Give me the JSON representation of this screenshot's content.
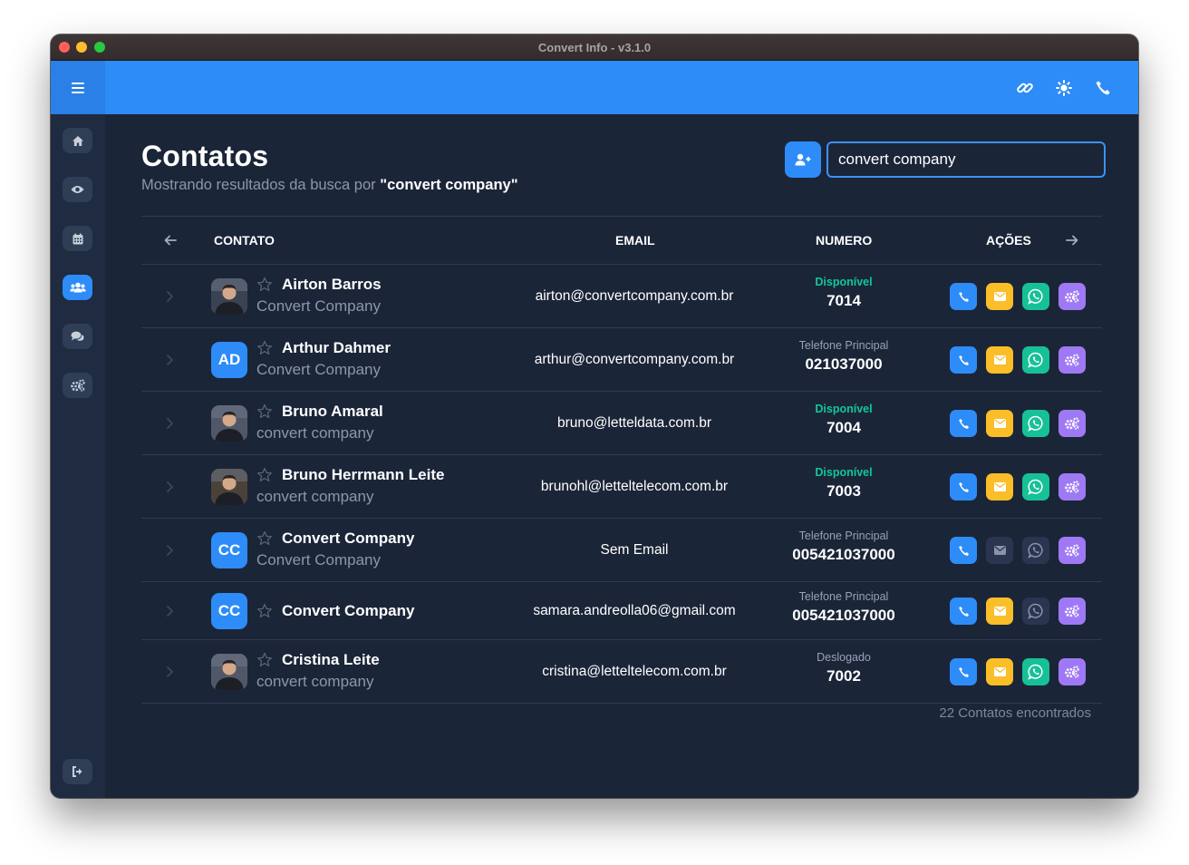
{
  "window": {
    "title": "Convert Info - v3.1.0"
  },
  "header": {
    "menu_icon": "hamburger-icon",
    "actions": [
      {
        "name": "link",
        "icon": "link-icon"
      },
      {
        "name": "theme",
        "icon": "sun-icon"
      },
      {
        "name": "phone",
        "icon": "phone-icon"
      }
    ]
  },
  "sidebar": {
    "items": [
      {
        "name": "home",
        "icon": "home-icon",
        "active": false
      },
      {
        "name": "monitor",
        "icon": "eye-icon",
        "active": false
      },
      {
        "name": "calendar",
        "icon": "calendar-icon",
        "active": false
      },
      {
        "name": "contacts",
        "icon": "users-icon",
        "active": true
      },
      {
        "name": "chat",
        "icon": "comments-icon",
        "active": false
      },
      {
        "name": "settings",
        "icon": "gears-icon",
        "active": false
      }
    ],
    "logout_icon": "sign-out-icon"
  },
  "page": {
    "title": "Contatos",
    "subtitle_prefix": "Mostrando resultados da busca por",
    "subtitle_query": "\"convert company\"",
    "search_value": "convert company",
    "add_contact_icon": "user-plus-icon"
  },
  "table": {
    "headers": {
      "contact": "CONTATO",
      "email": "EMAIL",
      "number": "NUMERO",
      "actions": "AÇÕES"
    },
    "rows": [
      {
        "name": "Airton Barros",
        "company": "Convert Company",
        "avatar_type": "photo",
        "initials": "",
        "email": "airton@convertcompany.com.br",
        "status": "Disponível",
        "status_type": "available",
        "number": "7014",
        "email_enabled": true,
        "whatsapp_enabled": true
      },
      {
        "name": "Arthur Dahmer",
        "company": "Convert Company",
        "avatar_type": "initials",
        "initials": "AD",
        "email": "arthur@convertcompany.com.br",
        "status": "Telefone Principal",
        "status_type": "neutral",
        "number": "021037000",
        "email_enabled": true,
        "whatsapp_enabled": true
      },
      {
        "name": "Bruno Amaral",
        "company": "convert company",
        "avatar_type": "photo",
        "initials": "",
        "email": "bruno@letteldata.com.br",
        "status": "Disponível",
        "status_type": "available",
        "number": "7004",
        "email_enabled": true,
        "whatsapp_enabled": true
      },
      {
        "name": "Bruno Herrmann Leite",
        "company": "convert company",
        "avatar_type": "photo",
        "initials": "",
        "email": "brunohl@letteltelecom.com.br",
        "status": "Disponível",
        "status_type": "available",
        "number": "7003",
        "email_enabled": true,
        "whatsapp_enabled": true
      },
      {
        "name": "Convert Company",
        "company": "Convert Company",
        "avatar_type": "initials",
        "initials": "CC",
        "email": "Sem Email",
        "status": "Telefone Principal",
        "status_type": "neutral",
        "number": "005421037000",
        "email_enabled": false,
        "whatsapp_enabled": false
      },
      {
        "name": "Convert Company",
        "company": "",
        "avatar_type": "initials",
        "initials": "CC",
        "email": "samara.andreolla06@gmail.com",
        "status": "Telefone Principal",
        "status_type": "neutral",
        "number": "005421037000",
        "email_enabled": true,
        "whatsapp_enabled": false
      },
      {
        "name": "Cristina Leite",
        "company": "convert company",
        "avatar_type": "photo",
        "initials": "",
        "email": "cristina@letteltelecom.com.br",
        "status": "Deslogado",
        "status_type": "neutral",
        "number": "7002",
        "email_enabled": true,
        "whatsapp_enabled": true
      }
    ],
    "footer_count": "22 Contatos encontrados"
  },
  "colors": {
    "accent": "#2d8cf7",
    "background": "#1b2538",
    "sidebar": "#1f2b40",
    "available": "#10c79a",
    "mail": "#f9be28",
    "whatsapp": "#17c197",
    "config": "#9f79f5"
  }
}
